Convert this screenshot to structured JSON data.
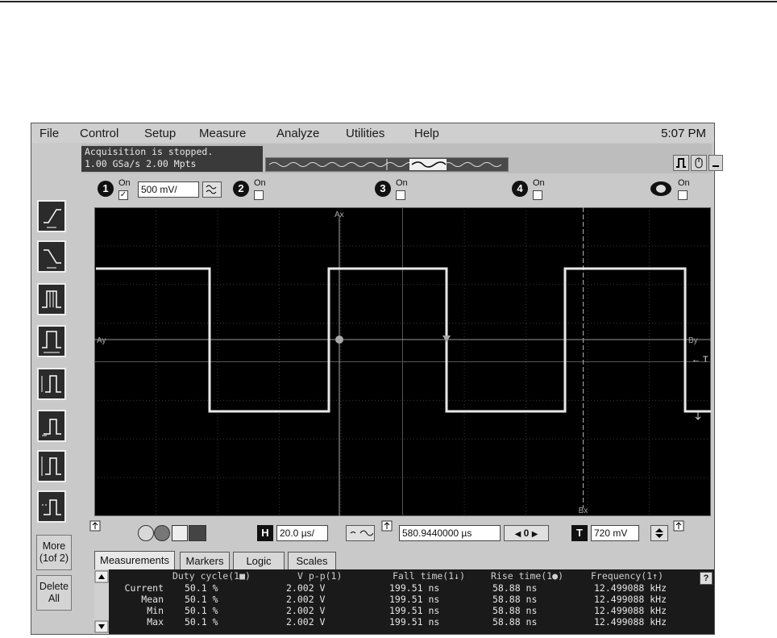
{
  "menu": {
    "items": [
      "File",
      "Control",
      "Setup",
      "Measure",
      "Analyze",
      "Utilities",
      "Help"
    ],
    "clock": "5:07 PM"
  },
  "status": {
    "line1": "Acquisition is stopped.",
    "line2": "1.00 GSa/s  2.00 Mpts"
  },
  "channels": {
    "ch1": {
      "num": "1",
      "on": "On",
      "scale": "500 mV/"
    },
    "ch2": {
      "num": "2",
      "on": "On"
    },
    "ch3": {
      "num": "3",
      "on": "On"
    },
    "ch4": {
      "num": "4",
      "on": "On"
    },
    "math": {
      "on": "On"
    }
  },
  "left_panel": {
    "more": "More\n(1of 2)",
    "delete": "Delete\nAll"
  },
  "scope": {
    "markers": {
      "ax": "Ax",
      "ay": "Ay",
      "bx": "Bx",
      "by": "By",
      "trig": "← T"
    }
  },
  "horizontal": {
    "h_label": "H",
    "timebase": "20.0 µs/",
    "position": "580.9440000 µs",
    "t_label": "T",
    "trigger_level": "720 mV",
    "nav_zero": "0"
  },
  "tabs": [
    "Measurements",
    "Markers",
    "Logic",
    "Scales"
  ],
  "measurements": {
    "headers": [
      "Duty cycle(1■)",
      "V p-p(1)",
      "Fall time(1↓)",
      "Rise time(1●)",
      "Frequency(1↑)"
    ],
    "rows": [
      {
        "label": "Current",
        "values": [
          "50.1 %",
          "2.002 V",
          "199.51 ns",
          "58.88 ns",
          "12.499088 kHz"
        ]
      },
      {
        "label": "Mean",
        "values": [
          "50.1 %",
          "2.002 V",
          "199.51 ns",
          "58.88 ns",
          "12.499088 kHz"
        ]
      },
      {
        "label": "Min",
        "values": [
          "50.1 %",
          "2.002 V",
          "199.51 ns",
          "58.88 ns",
          "12.499088 kHz"
        ]
      },
      {
        "label": "Max",
        "values": [
          "50.1 %",
          "2.002 V",
          "199.51 ns",
          "58.88 ns",
          "12.499088 kHz"
        ]
      }
    ],
    "help": "?"
  }
}
